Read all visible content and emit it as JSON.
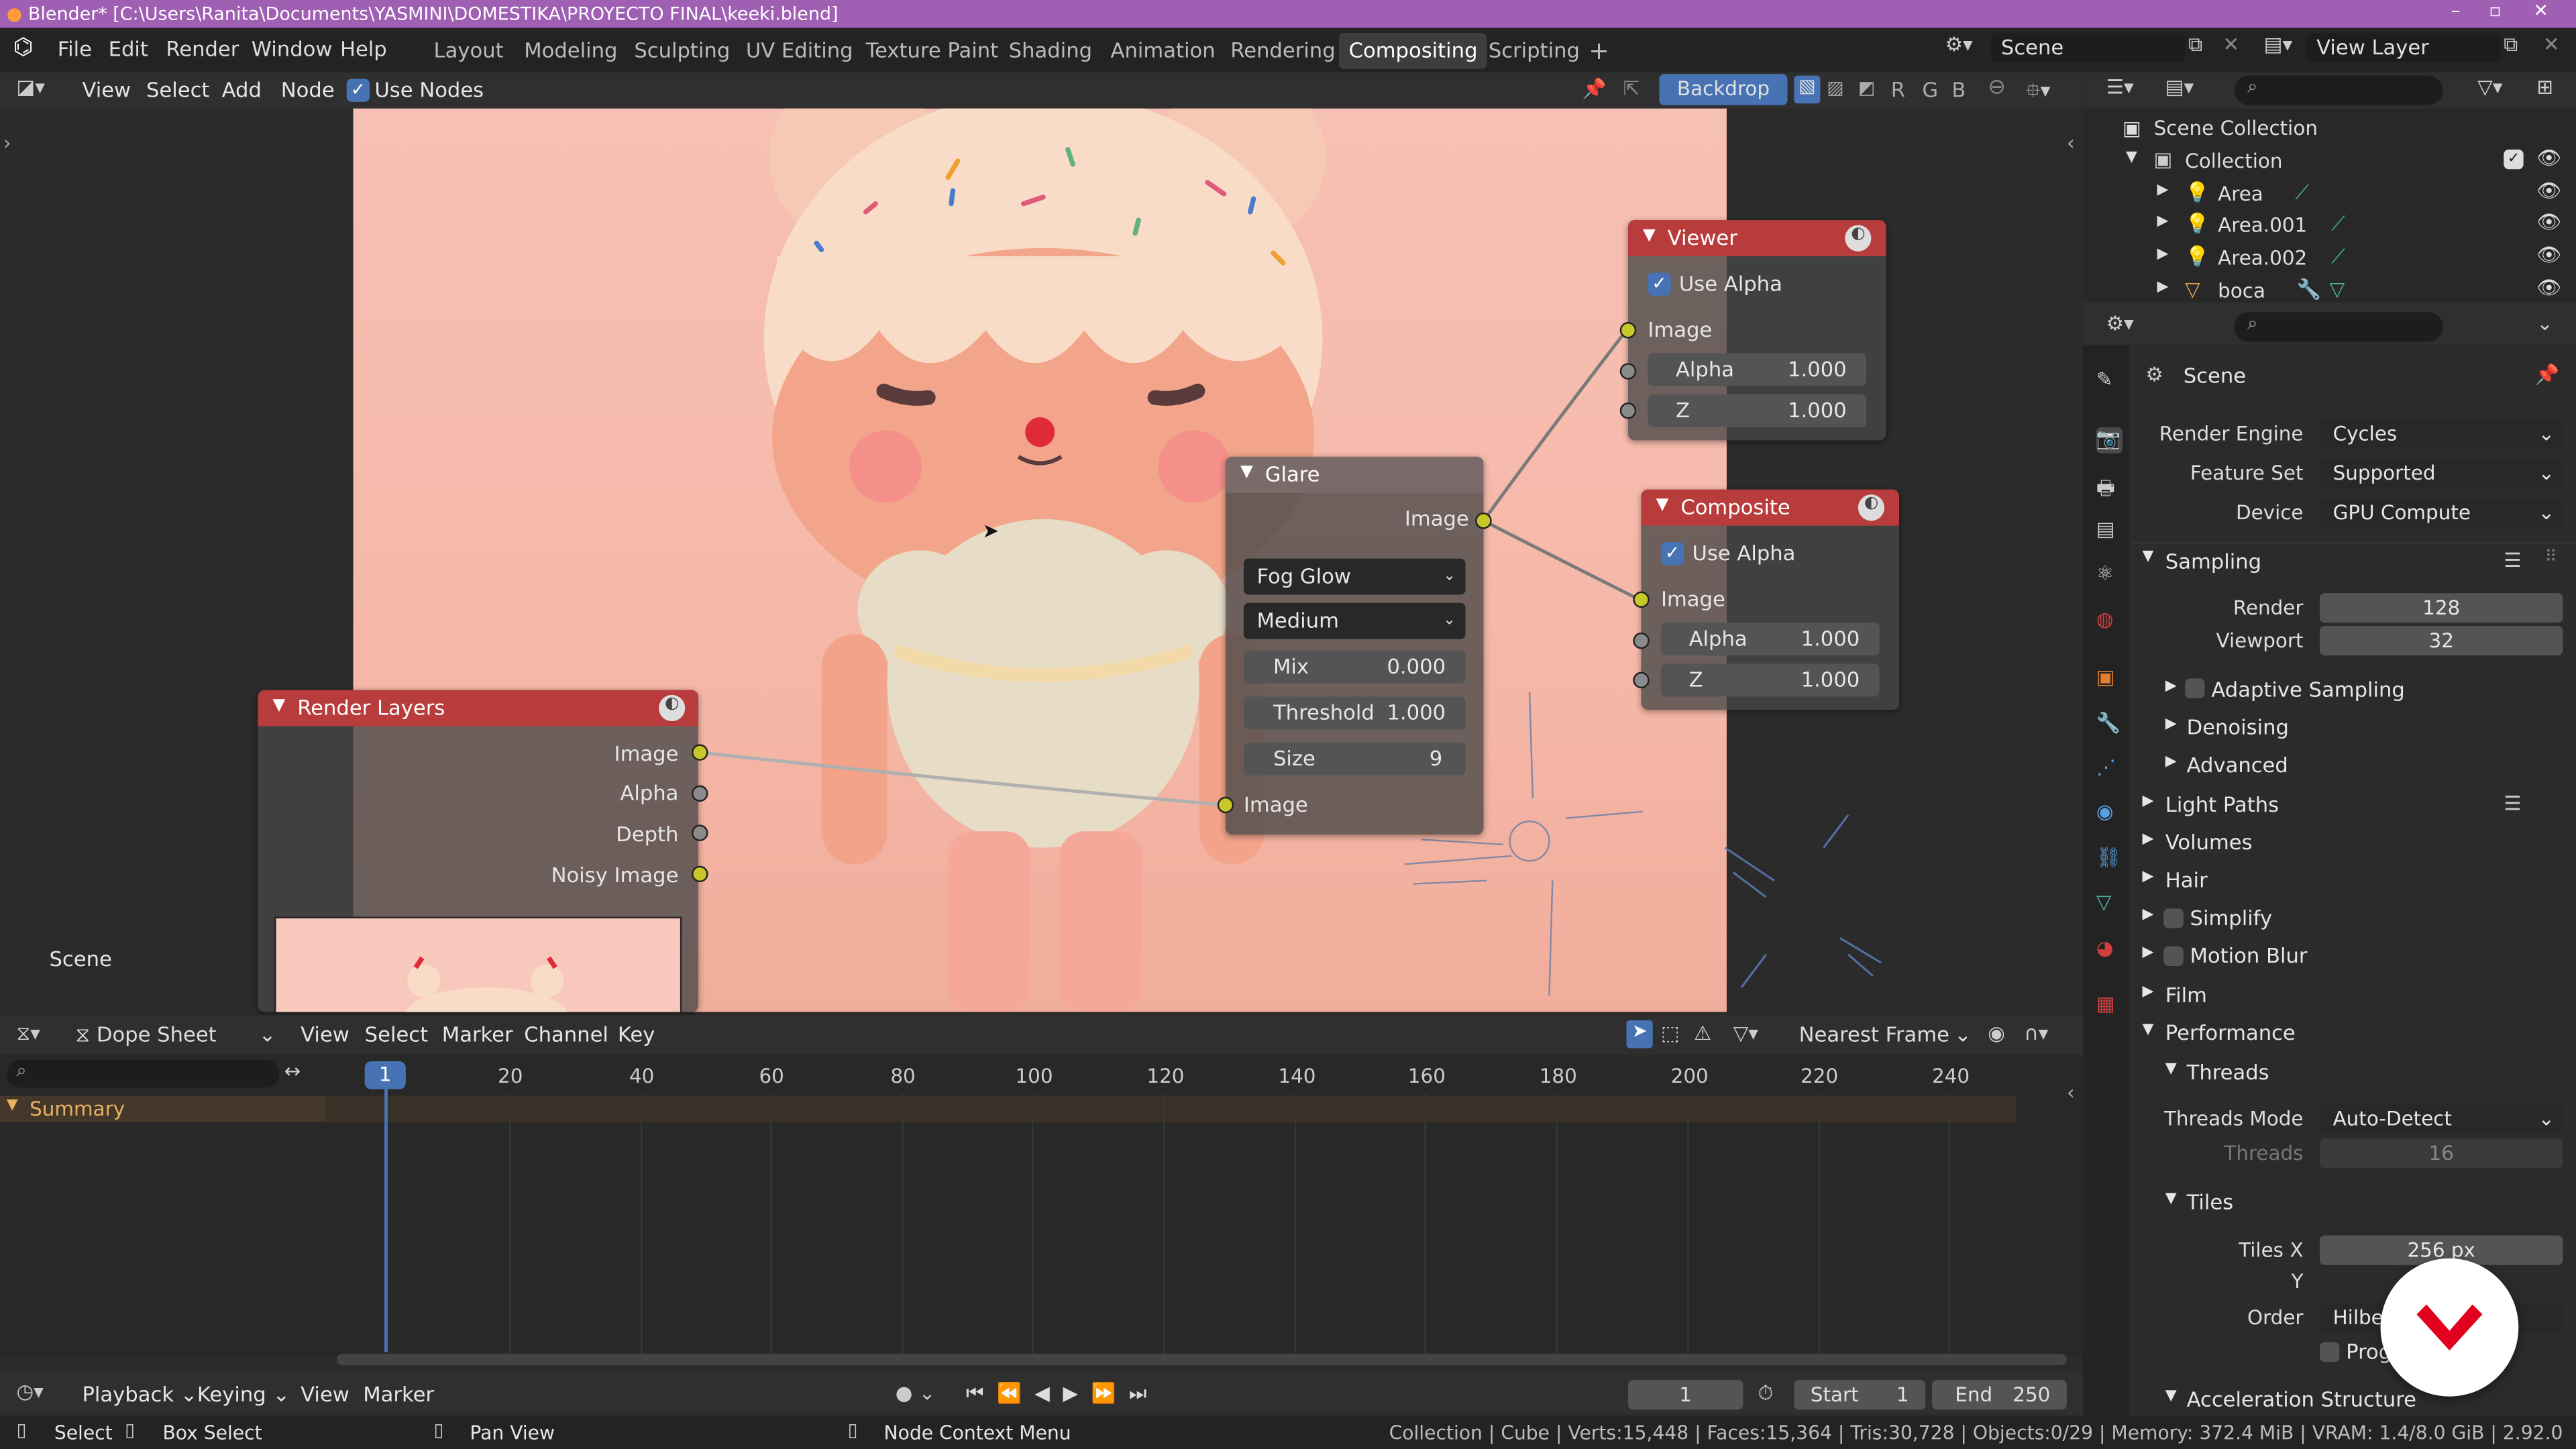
{
  "window": {
    "title": "Blender* [C:\\Users\\Ranita\\Documents\\YASMINI\\DOMESTIKA\\PROYECTO FINAL\\keeki.blend]"
  },
  "menu": [
    "File",
    "Edit",
    "Render",
    "Window",
    "Help"
  ],
  "workspaces": [
    "Layout",
    "Modeling",
    "Sculpting",
    "UV Editing",
    "Texture Paint",
    "Shading",
    "Animation",
    "Rendering",
    "Compositing",
    "Scripting"
  ],
  "active_workspace": "Compositing",
  "scene_name": "Scene",
  "view_layer": "View Layer",
  "node_header": {
    "items": [
      "View",
      "Select",
      "Add",
      "Node"
    ],
    "use_nodes": "Use Nodes",
    "backdrop": "Backdrop",
    "channels": [
      "R",
      "G",
      "B"
    ]
  },
  "viewport_scene_label": "Scene",
  "nodes": {
    "viewer": {
      "title": "Viewer",
      "use_alpha": "Use Alpha",
      "image": "Image",
      "alpha_label": "Alpha",
      "alpha": "1.000",
      "z_label": "Z",
      "z": "1.000"
    },
    "glare": {
      "title": "Glare",
      "image_out": "Image",
      "type": "Fog Glow",
      "quality": "Medium",
      "mix_label": "Mix",
      "mix": "0.000",
      "threshold_label": "Threshold",
      "threshold": "1.000",
      "size_label": "Size",
      "size": "9",
      "image_in": "Image"
    },
    "composite": {
      "title": "Composite",
      "use_alpha": "Use Alpha",
      "image": "Image",
      "alpha_label": "Alpha",
      "alpha": "1.000",
      "z_label": "Z",
      "z": "1.000"
    },
    "render_layers": {
      "title": "Render Layers",
      "outputs": [
        "Image",
        "Alpha",
        "Depth",
        "Noisy Image"
      ]
    }
  },
  "outliner": {
    "scene_collection": "Scene Collection",
    "collection": "Collection",
    "items": [
      "Area",
      "Area.001",
      "Area.002",
      "boca"
    ]
  },
  "properties": {
    "title": "Scene",
    "render_engine_label": "Render Engine",
    "render_engine": "Cycles",
    "feature_set_label": "Feature Set",
    "feature_set": "Supported",
    "device_label": "Device",
    "device": "GPU Compute",
    "sampling": "Sampling",
    "render_label": "Render",
    "render": "128",
    "viewport_label": "Viewport",
    "viewport": "32",
    "adaptive": "Adaptive Sampling",
    "denoising": "Denoising",
    "advanced": "Advanced",
    "light_paths": "Light Paths",
    "volumes": "Volumes",
    "hair": "Hair",
    "simplify": "Simplify",
    "motion_blur": "Motion Blur",
    "film": "Film",
    "performance": "Performance",
    "threads": "Threads",
    "threads_mode_label": "Threads Mode",
    "threads_mode": "Auto-Detect",
    "threads_label": "Threads",
    "threads_value": "16",
    "tiles": "Tiles",
    "tiles_x_label": "Tiles X",
    "tiles_x": "256 px",
    "tiles_y_label": "Y",
    "order_label": "Order",
    "order": "Hilber",
    "progressive": "Prog",
    "accel": "Acceleration Structure"
  },
  "dopesheet": {
    "mode": "Dope Sheet",
    "menu": [
      "View",
      "Select",
      "Marker",
      "Channel",
      "Key"
    ],
    "snap": "Nearest Frame",
    "summary": "Summary",
    "frame_ticks": [
      "1",
      "20",
      "40",
      "60",
      "80",
      "100",
      "120",
      "140",
      "160",
      "180",
      "200",
      "220",
      "240"
    ]
  },
  "timeline": {
    "playback": "Playback",
    "keying": "Keying",
    "view": "View",
    "marker": "Marker",
    "current": "1",
    "start_label": "Start",
    "start": "1",
    "end_label": "End",
    "end": "250"
  },
  "status": {
    "select": "Select",
    "box_select": "Box Select",
    "pan": "Pan View",
    "context": "Node Context Menu",
    "stats": "Collection | Cube | Verts:15,448 | Faces:15,364 | Tris:30,728 | Objects:0/29 | Memory: 372.4 MiB | VRAM: 1.4/8.0 GiB | 2.92.0"
  },
  "colors": {
    "accent": "#4772b3",
    "title_bar": "#9f5fb3",
    "node_header_red": "#b93c3c",
    "socket_yellow": "#c7c729",
    "logo_red": "#e1001e"
  }
}
